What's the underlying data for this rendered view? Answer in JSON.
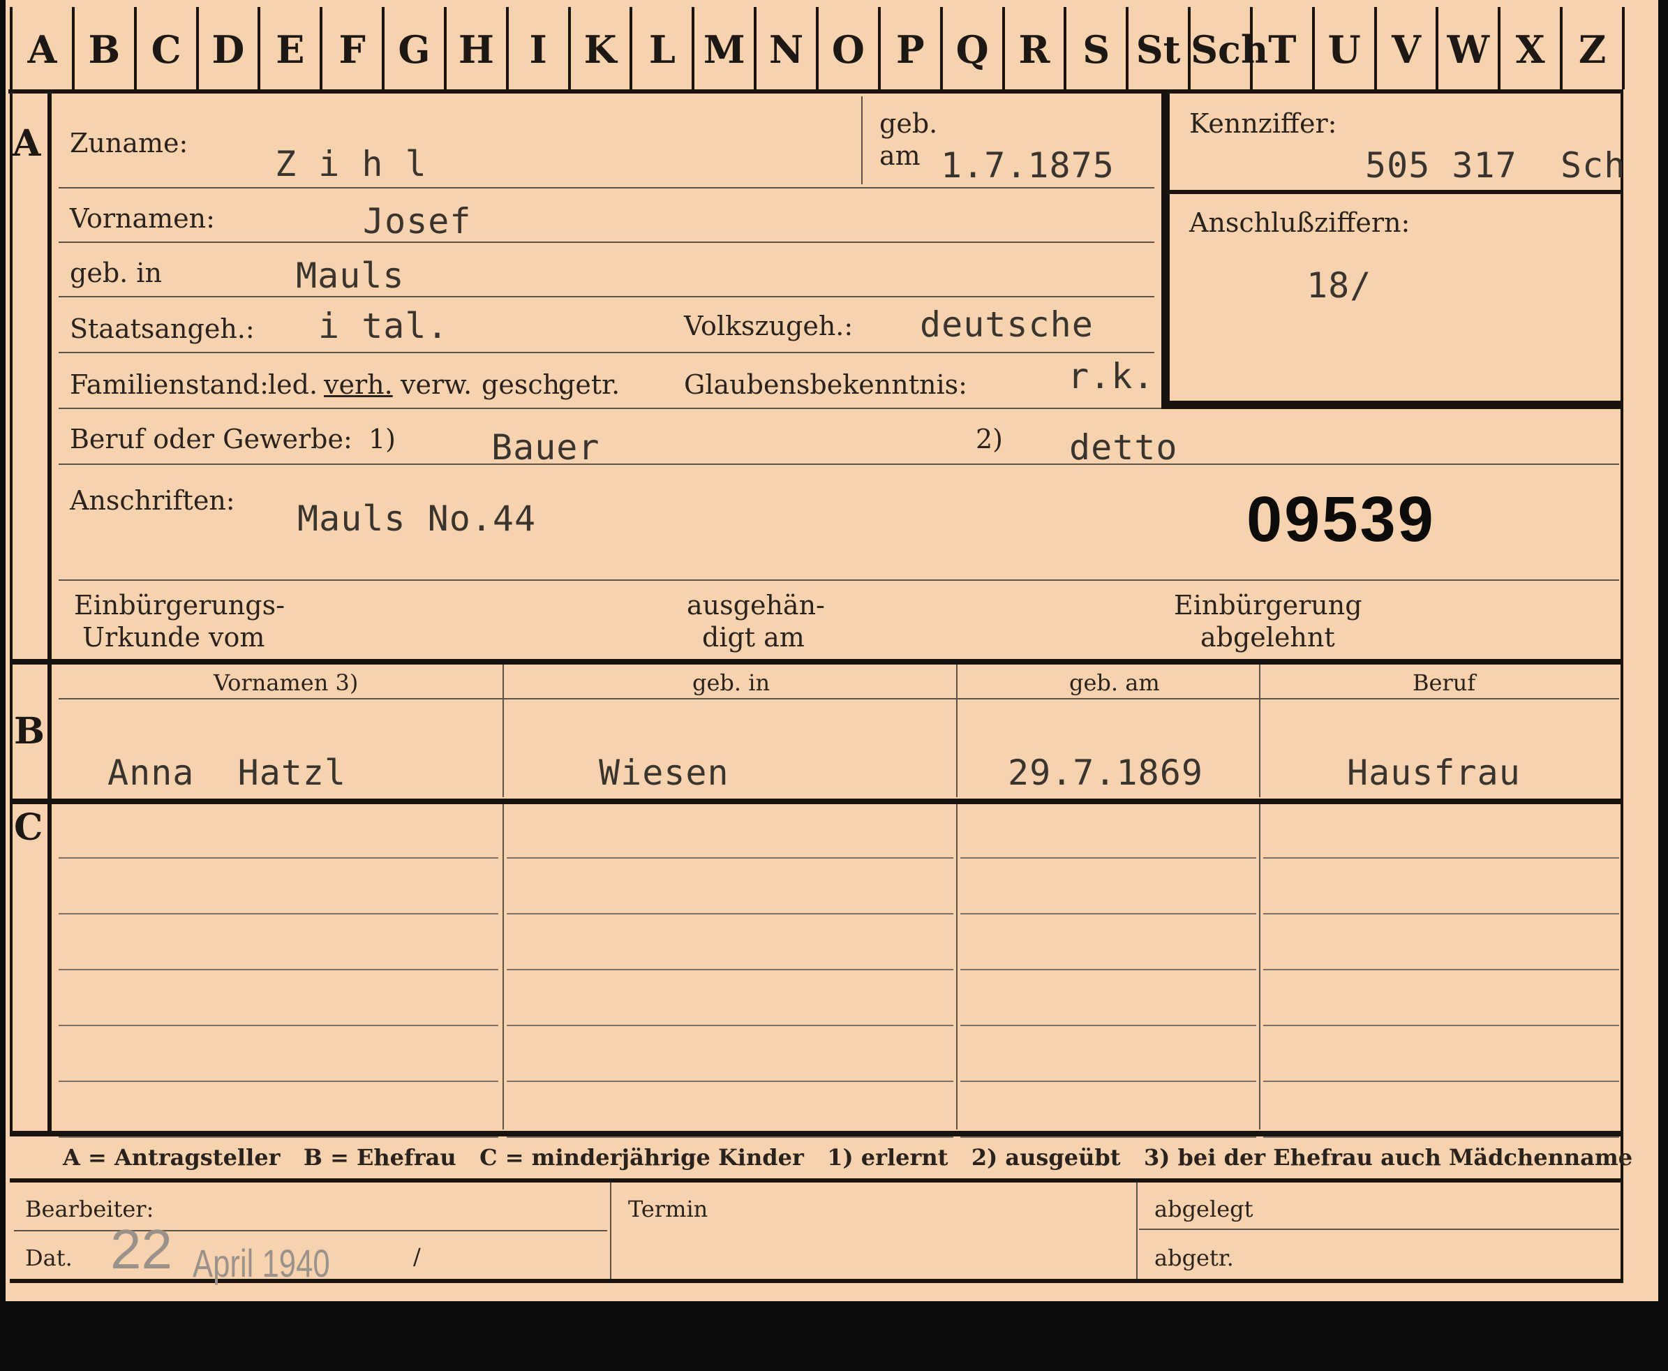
{
  "tabs": [
    "A",
    "B",
    "C",
    "D",
    "E",
    "F",
    "G",
    "H",
    "I",
    "K",
    "L",
    "M",
    "N",
    "O",
    "P",
    "Q",
    "R",
    "S",
    "St",
    "Sch",
    "T",
    "U",
    "V",
    "W",
    "X",
    "Z"
  ],
  "sections": {
    "a": "A",
    "b": "B",
    "c": "C"
  },
  "applicant": {
    "surname_label": "Zuname:",
    "surname": "Z i h l",
    "birth_label_1": "geb.",
    "birth_label_2": "am",
    "birth_date": "1.7.1875",
    "forenames_label": "Vornamen:",
    "forenames": "Josef",
    "birthplace_label": "geb. in",
    "birthplace": "Mauls",
    "citizenship_label": "Staatsangeh.:",
    "citizenship": "i tal.",
    "ethnicity_label": "Volkszugeh.:",
    "ethnicity": "deutsche",
    "family_status_label": "Familienstand:",
    "family_status_options": [
      "led.",
      "verh.",
      "verw.",
      "gesch.",
      "getr."
    ],
    "religion_label": "Glaubensbekenntnis:",
    "religion": "r.k.",
    "occupation_label": "Beruf oder Gewerbe:",
    "occupation_learned_mark": "1)",
    "occupation_learned": "Bauer",
    "occupation_practiced_mark": "2)",
    "occupation_practiced": "detto",
    "address_label": "Anschriften:",
    "address": "Mauls No.44",
    "case_number": "09539",
    "naturalization_cert_label_1": "Einbürgerungs-",
    "naturalization_cert_label_2": "Urkunde vom",
    "handed_out_label_1": "ausgehän-",
    "handed_out_label_2": "digt am",
    "rejected_label_1": "Einbürgerung",
    "rejected_label_2": "abgelehnt"
  },
  "id_box": {
    "id_label": "Kennziffer:",
    "id_value": "505 317",
    "id_suffix": "Sch",
    "link_label": "Anschlußziffern:",
    "link_value": "18/"
  },
  "spouse_table": {
    "headers": [
      "Vornamen 3)",
      "geb. in",
      "geb. am",
      "Beruf"
    ],
    "row": [
      "Anna  Hatzl",
      "Wiesen",
      "29.7.1869",
      "Hausfrau"
    ]
  },
  "children_rows": 6,
  "legend": "A = Antragsteller   B = Ehefrau   C = minderjährige Kinder   1) erlernt   2) ausgeübt   3) bei der Ehefrau auch Mädchenname",
  "footer": {
    "processor_label": "Bearbeiter:",
    "date_label": "Dat.",
    "stamp_day": "22",
    "stamp_rest": "April 1940",
    "stamp_slash": "/",
    "deadline_label": "Termin",
    "filed_label": "abgelegt",
    "removed_label": "abgetr."
  },
  "colors": {
    "card": "#f7d2ae",
    "ink": "#2a221c",
    "background": "#0c0c0c"
  }
}
